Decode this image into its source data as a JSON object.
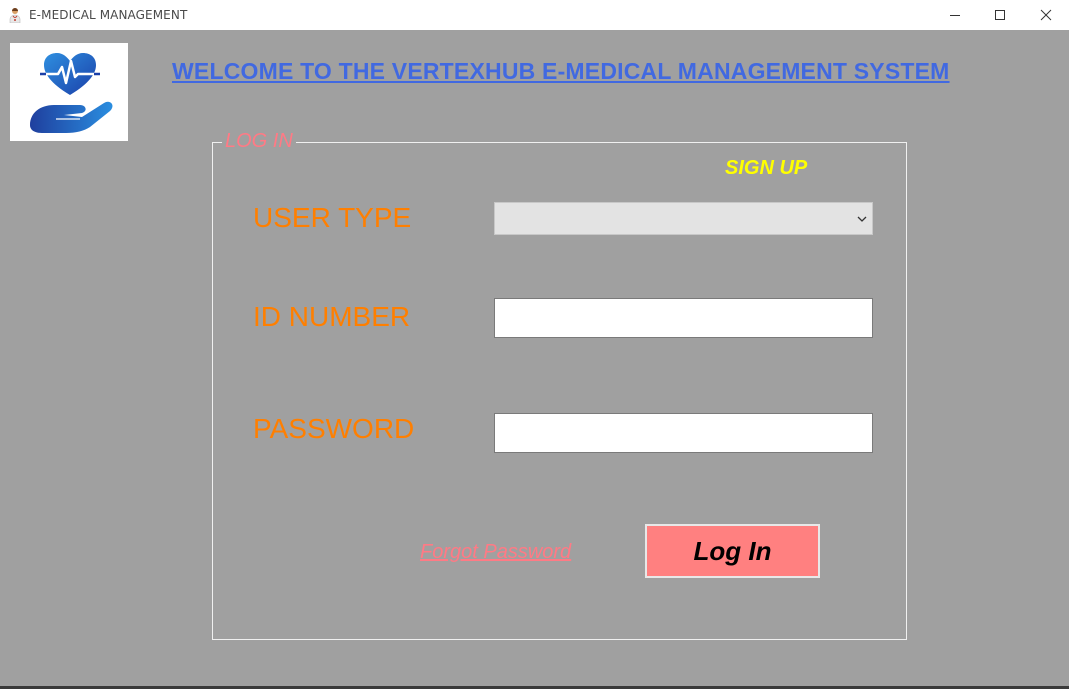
{
  "window": {
    "title": "E-MEDICAL MANAGEMENT",
    "app_icon": "doctor-icon",
    "controls": [
      "minimize-icon",
      "maximize-icon",
      "close-icon"
    ]
  },
  "header": {
    "logo_icon": "heart-hand-care-icon",
    "welcome": "WELCOME TO THE VERTEXHUB  E-MEDICAL MANAGEMENT SYSTEM"
  },
  "login": {
    "legend": "LOG IN",
    "signup_label": "SIGN UP",
    "user_type_label": "USER TYPE",
    "user_type_value": "",
    "id_label": "ID NUMBER",
    "id_value": "",
    "password_label": "PASSWORD",
    "password_value": "",
    "forgot_label": "Forgot Password",
    "login_button": "Log In"
  },
  "colors": {
    "background": "#a0a0a0",
    "welcome_text": "#4169e1",
    "legend_text": "#ff7a85",
    "signup_text": "#ffff00",
    "label_text": "#ff7f00",
    "button_bg": "#ff8080"
  }
}
